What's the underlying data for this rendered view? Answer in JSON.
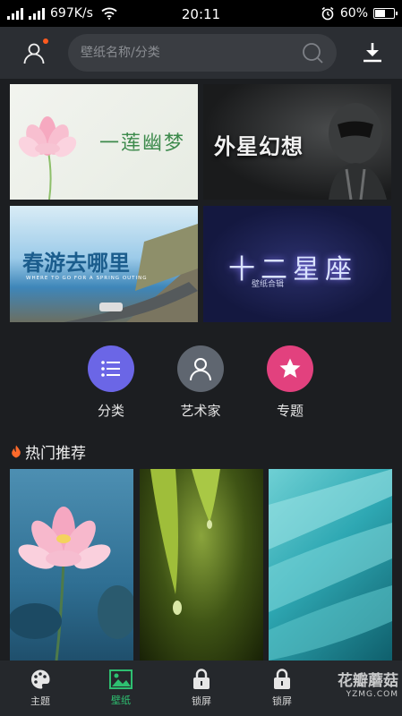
{
  "status_bar": {
    "network_speed": "697K/s",
    "time": "20:11",
    "battery": "60%",
    "battery_level": 0.6
  },
  "header": {
    "search_placeholder": "壁纸名称/分类",
    "icons": [
      "user-icon",
      "search-icon",
      "download-icon"
    ]
  },
  "banners": [
    {
      "title": "一莲幽梦"
    },
    {
      "title": "外星幻想"
    },
    {
      "title": "春游去哪里",
      "subtitle": "WHERE TO GO FOR A SPRING OUTING"
    },
    {
      "title": "十二星座",
      "subtitle": "壁纸合辑"
    }
  ],
  "categories": [
    {
      "label": "分类",
      "icon": "list-icon",
      "color": "#6b66e6"
    },
    {
      "label": "艺术家",
      "icon": "person-icon",
      "color": "#5f6670"
    },
    {
      "label": "专题",
      "icon": "star-icon",
      "color": "#e2417e"
    }
  ],
  "hot": {
    "title": "热门推荐",
    "icon": "flame-icon"
  },
  "bottom_nav": [
    {
      "label": "主题",
      "icon": "palette-icon",
      "active": false
    },
    {
      "label": "壁纸",
      "icon": "image-icon",
      "active": true
    },
    {
      "label": "锁屏",
      "icon": "lock-icon",
      "active": false
    },
    {
      "label": "锁屏",
      "icon": "lock-icon",
      "active": false
    }
  ],
  "watermark": {
    "line1": "花瓣蘑菇",
    "line2": "YZMG.COM"
  },
  "colors": {
    "accent": "#2ec071",
    "notification": "#ff5a1f",
    "background": "#1c1e21"
  }
}
